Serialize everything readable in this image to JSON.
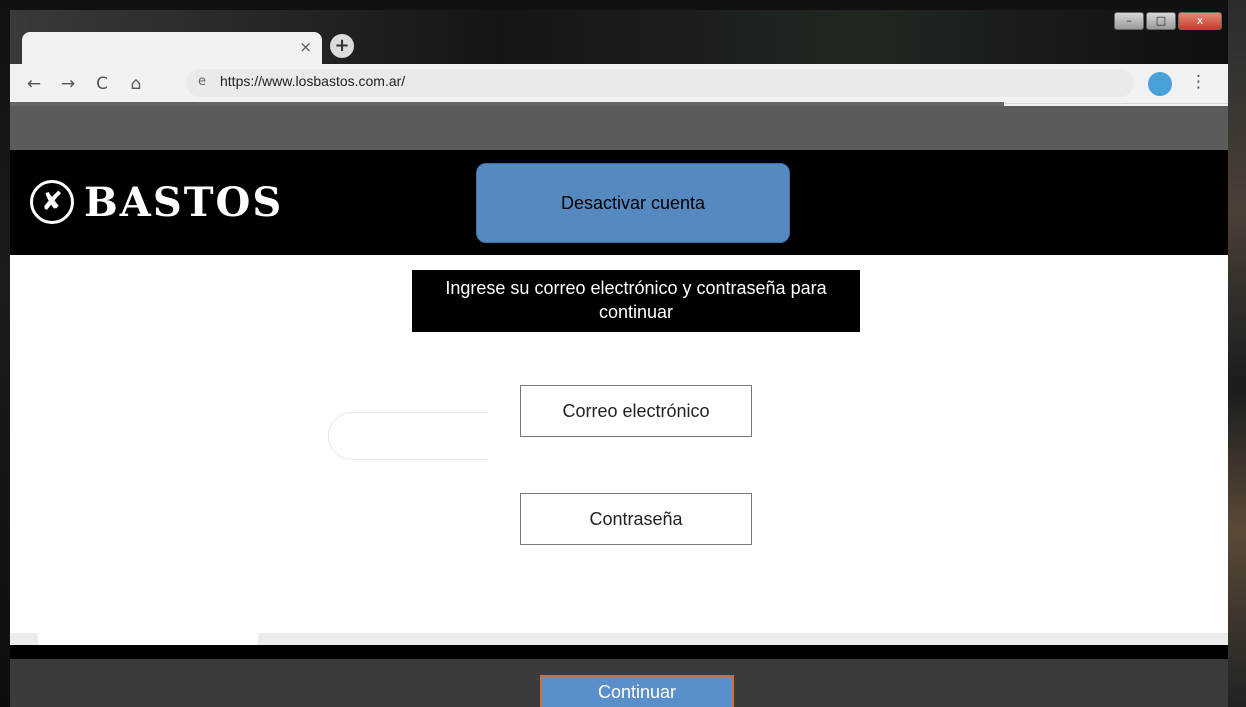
{
  "browser": {
    "tab_close": "×",
    "new_tab": "+",
    "url": "https://www.losbastos.com.ar/",
    "icons": {
      "back": "←",
      "forward": "→",
      "reload": "C",
      "home": "⌂",
      "site": "e",
      "menu": "⋮"
    },
    "window_controls": {
      "minimize": "–",
      "maximize": "□",
      "close": "x"
    }
  },
  "header": {
    "logo_emblem": "✘",
    "logo_text": "BASTOS",
    "deactivate_label": "Desactivar cuenta"
  },
  "form": {
    "instruction": "Ingrese su correo electrónico y contraseña para continuar",
    "email_label": "Correo electrónico",
    "password_label": "Contraseña"
  },
  "footer": {
    "continue_label": "Continuar"
  },
  "colors": {
    "header_bg": "#000000",
    "button_blue": "#5689c0",
    "continue_border": "#c9733a",
    "footer_bg": "#3c3a3a"
  }
}
